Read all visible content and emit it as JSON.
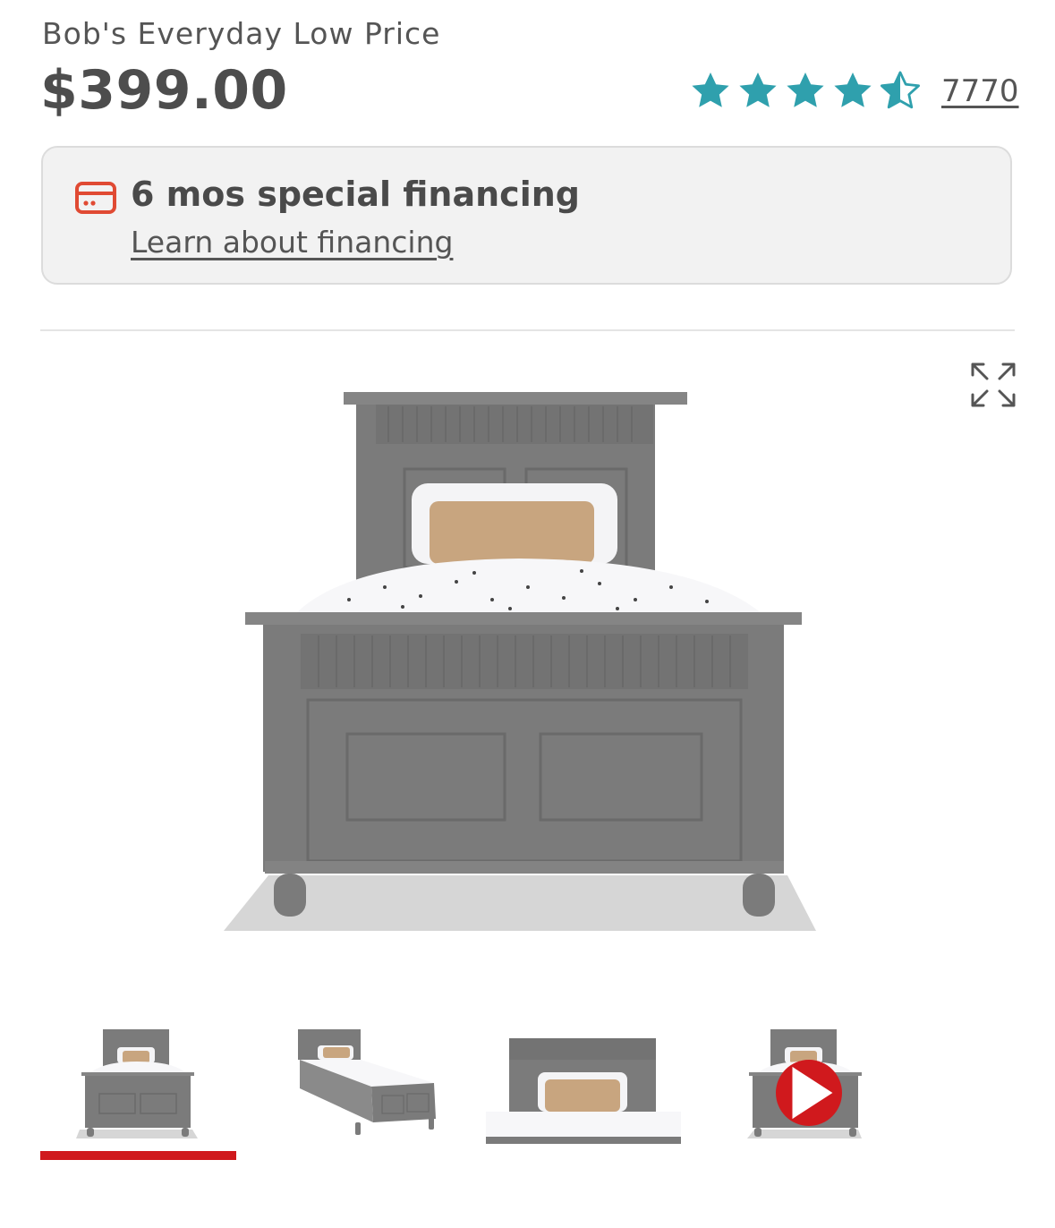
{
  "pricing": {
    "label": "Bob's Everyday Low Price",
    "price": "$399.00"
  },
  "rating": {
    "stars": 4.5,
    "max_stars": 5,
    "review_count": "7770",
    "star_color": "#2fa0ad"
  },
  "financing": {
    "icon": "credit-card-icon",
    "icon_color": "#e04a33",
    "title": "6 mos special financing",
    "link_text": "Learn about financing"
  },
  "gallery": {
    "expand_icon": "expand-icon",
    "main_image": "gray-panel-bed-image",
    "thumbnails": [
      {
        "name": "bed-front-view-thumbnail",
        "selected": true
      },
      {
        "name": "bed-angled-view-thumbnail",
        "selected": false
      },
      {
        "name": "bed-headboard-view-thumbnail",
        "selected": false
      },
      {
        "name": "bed-video-thumbnail",
        "selected": false,
        "video": true
      }
    ],
    "selected_color": "#d0191d"
  }
}
